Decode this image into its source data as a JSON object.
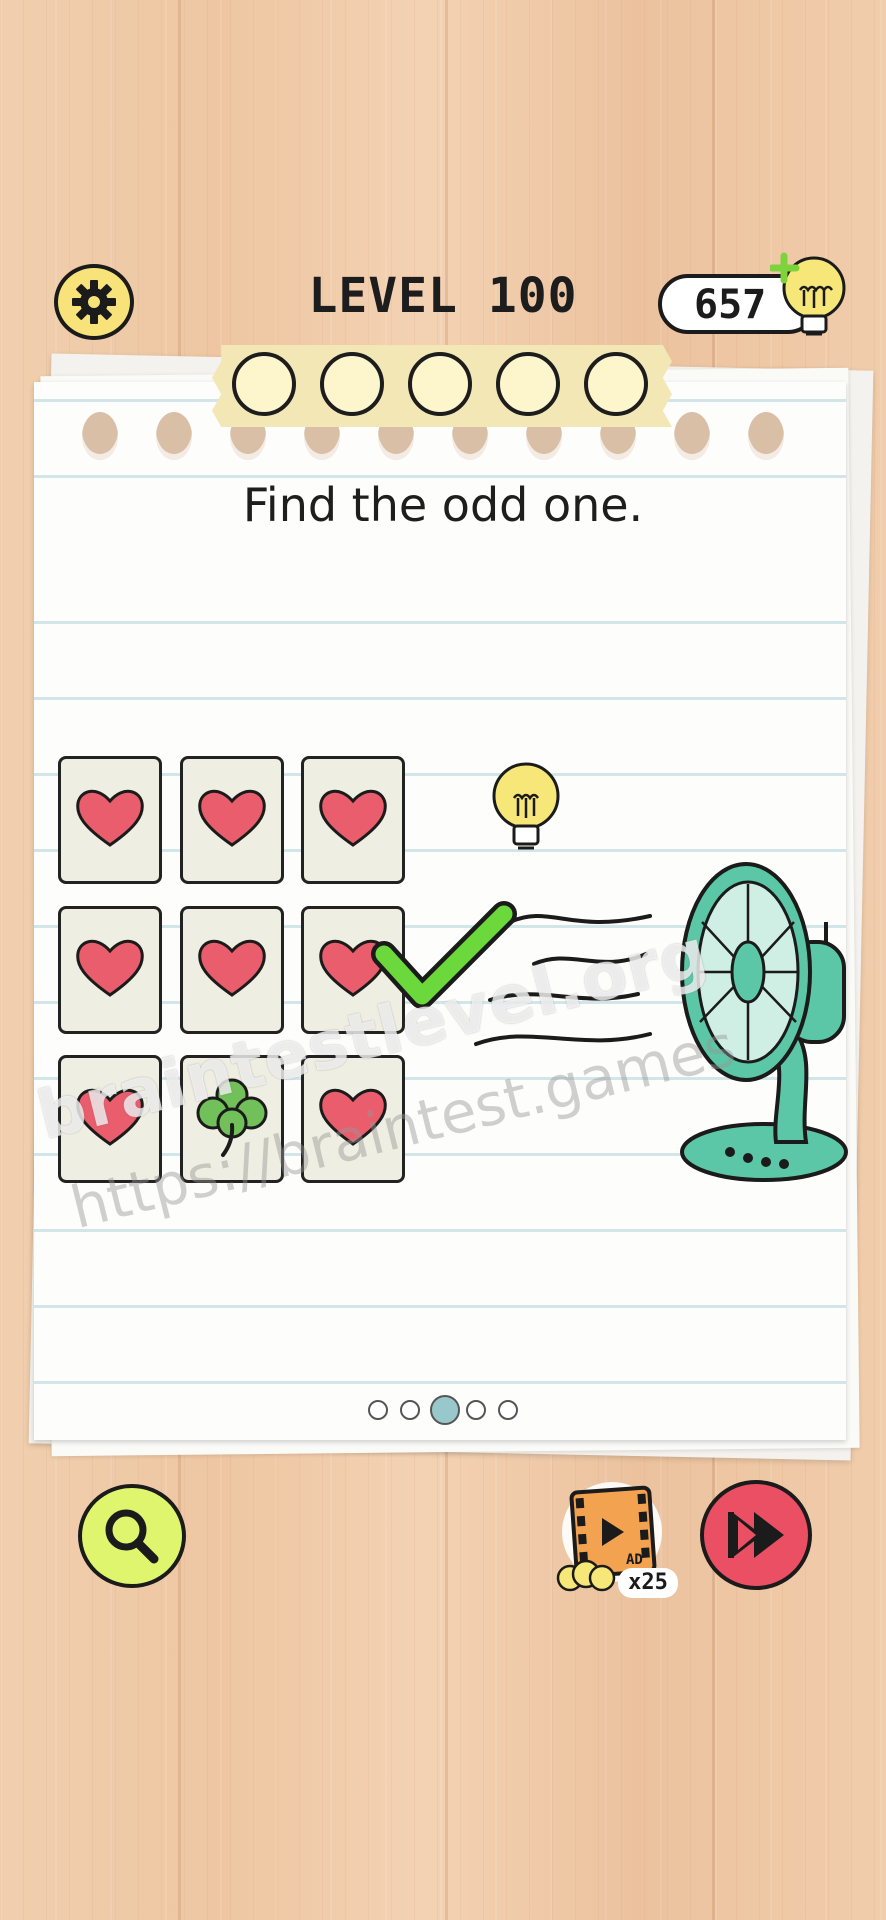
{
  "header": {
    "level_title": "LEVEL 100",
    "hint_count": "657"
  },
  "puzzle": {
    "instruction": "Find the odd one.",
    "cards": [
      "heart",
      "heart",
      "heart",
      "heart",
      "heart",
      "heart",
      "heart",
      "clover",
      "heart"
    ],
    "progress_circles_total": 5,
    "page_dots_total": 5,
    "page_dots_active_index": 2
  },
  "watermarks": {
    "line1": "braintestlevel.org",
    "line2": "https://braintest.games"
  },
  "footer": {
    "ad_label": "AD",
    "ad_reward": "x25"
  },
  "colors": {
    "heart": "#e95d6c",
    "clover": "#72c05a",
    "checkmark": "#6bd93c",
    "fan": "#5cc7a6",
    "bulb": "#f7e778",
    "skip_button": "#ea4f63",
    "search_button": "#dff56e"
  }
}
